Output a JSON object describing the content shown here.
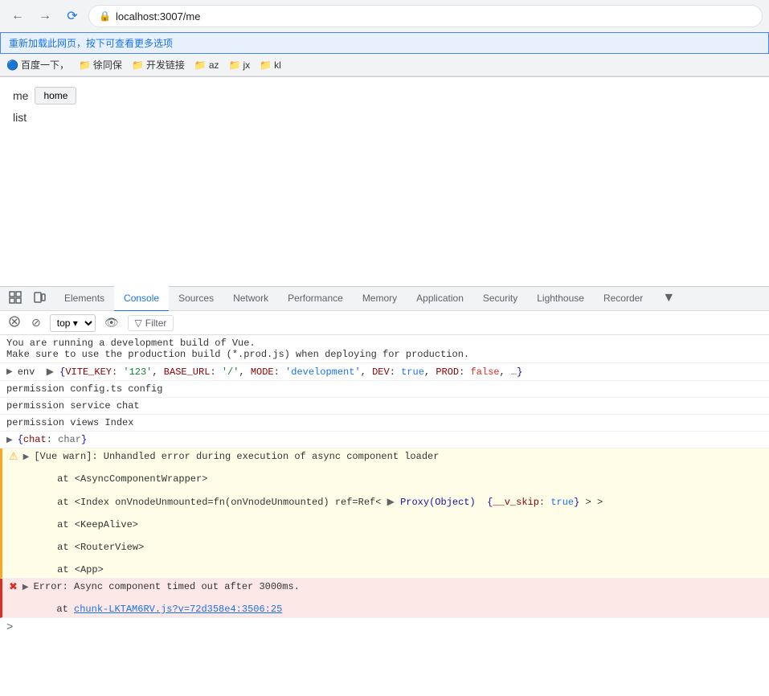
{
  "browser": {
    "url": "localhost:3007/me",
    "tooltip": "重新加载此网页，按下可查看更多选项",
    "bookmarks": [
      {
        "label": "百度一下，",
        "icon": "🔵"
      },
      {
        "label": "徐同保"
      },
      {
        "label": "开发链接"
      },
      {
        "label": "az"
      },
      {
        "label": "jx"
      },
      {
        "label": "kl"
      }
    ]
  },
  "page": {
    "title": "me",
    "home_btn": "home",
    "list_label": "list"
  },
  "devtools": {
    "tabs": [
      {
        "label": "Elements",
        "active": false
      },
      {
        "label": "Console",
        "active": true
      },
      {
        "label": "Sources",
        "active": false
      },
      {
        "label": "Network",
        "active": false
      },
      {
        "label": "Performance",
        "active": false
      },
      {
        "label": "Memory",
        "active": false
      },
      {
        "label": "Application",
        "active": false
      },
      {
        "label": "Security",
        "active": false
      },
      {
        "label": "Lighthouse",
        "active": false
      },
      {
        "label": "Recorder",
        "active": false
      }
    ],
    "console": {
      "context": "top",
      "filter_placeholder": "Filter",
      "lines": [
        {
          "type": "info",
          "text": "You are running a development build of Vue.\nMake sure to use the production build (*.prod.js) when deploying for production."
        },
        {
          "type": "info",
          "text": "▶ env ▶ {VITE_KEY: '123', BASE_URL: '/', MODE: 'development', DEV: true, PROD: false, …}"
        },
        {
          "type": "info",
          "text": "permission config.ts config"
        },
        {
          "type": "info",
          "text": "permission service chat"
        },
        {
          "type": "info",
          "text": "permission views Index"
        },
        {
          "type": "info",
          "text": "▶ {chat: char}"
        },
        {
          "type": "warn",
          "text": "▶ [Vue warn]: Unhandled error during execution of async component loader\n    at <AsyncComponentWrapper>\n    at <Index onVnodeUnmounted=fn(onVnodeUnmounted) ref=Ref< ▶ Proxy(Object) {__v_skip: true} > >\n    at <KeepAlive>\n    at <RouterView>\n    at <App>"
        },
        {
          "type": "error",
          "text": "Error: Async component timed out after 3000ms.\n    at chunk-LKTAM6RV.js?v=72d358e4:3506:25",
          "link": "chunk-LKTAM6RV.js?v=72d358e4:3506:25"
        }
      ]
    }
  }
}
